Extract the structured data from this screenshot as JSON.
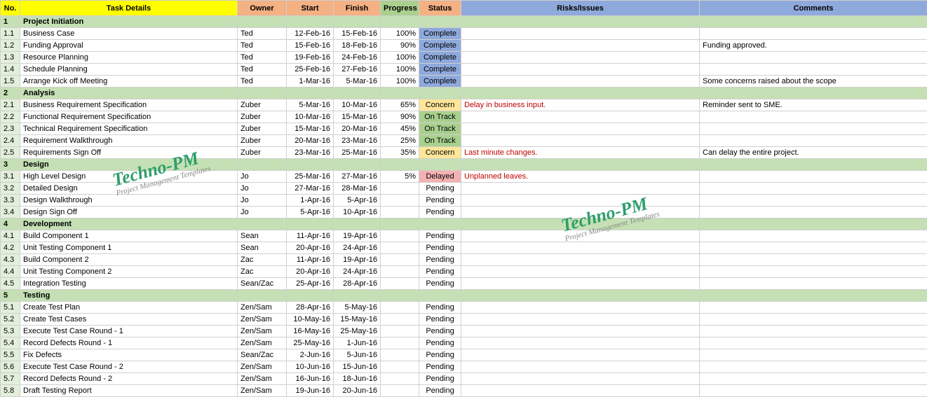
{
  "headers": {
    "no": "No.",
    "task": "Task Details",
    "owner": "Owner",
    "start": "Start",
    "finish": "Finish",
    "progress": "Progress",
    "status": "Status",
    "risks": "Risks/Issues",
    "comments": "Comments"
  },
  "watermark": {
    "main": "Techno-PM",
    "sub": "Project Management Templates"
  },
  "rows": [
    {
      "type": "section",
      "no": "1",
      "task": "Project Initiation"
    },
    {
      "type": "data",
      "no": "1.1",
      "task": "Business Case",
      "owner": "Ted",
      "start": "12-Feb-16",
      "finish": "15-Feb-16",
      "progress": "100%",
      "status": "Complete",
      "statusClass": "st-complete",
      "risk": "",
      "comment": ""
    },
    {
      "type": "data",
      "no": "1.2",
      "task": "Funding Approval",
      "owner": "Ted",
      "start": "15-Feb-16",
      "finish": "18-Feb-16",
      "progress": "90%",
      "status": "Complete",
      "statusClass": "st-complete",
      "risk": "",
      "comment": "Funding approved."
    },
    {
      "type": "data",
      "no": "1.3",
      "task": "Resource Planning",
      "owner": "Ted",
      "start": "19-Feb-16",
      "finish": "24-Feb-16",
      "progress": "100%",
      "status": "Complete",
      "statusClass": "st-complete",
      "risk": "",
      "comment": ""
    },
    {
      "type": "data",
      "no": "1.4",
      "task": "Schedule Planning",
      "owner": "Ted",
      "start": "25-Feb-16",
      "finish": "27-Feb-16",
      "progress": "100%",
      "status": "Complete",
      "statusClass": "st-complete",
      "risk": "",
      "comment": ""
    },
    {
      "type": "data",
      "no": "1.5",
      "task": "Arrange Kick off Meeting",
      "owner": "Ted",
      "start": "1-Mar-16",
      "finish": "5-Mar-16",
      "progress": "100%",
      "status": "Complete",
      "statusClass": "st-complete",
      "risk": "",
      "comment": "Some concerns raised about the scope"
    },
    {
      "type": "section",
      "no": "2",
      "task": "Analysis"
    },
    {
      "type": "data",
      "no": "2.1",
      "task": "Business Requirement Specification",
      "owner": "Zuber",
      "start": "5-Mar-16",
      "finish": "10-Mar-16",
      "progress": "65%",
      "status": "Concern",
      "statusClass": "st-concern",
      "risk": "Delay in business input.",
      "comment": "Reminder sent to SME."
    },
    {
      "type": "data",
      "no": "2.2",
      "task": "Functional Requirement Specification",
      "owner": "Zuber",
      "start": "10-Mar-16",
      "finish": "15-Mar-16",
      "progress": "90%",
      "status": "On Track",
      "statusClass": "st-ontrack",
      "risk": "",
      "comment": ""
    },
    {
      "type": "data",
      "no": "2.3",
      "task": "Technical Requirement Specification",
      "owner": "Zuber",
      "start": "15-Mar-16",
      "finish": "20-Mar-16",
      "progress": "45%",
      "status": "On Track",
      "statusClass": "st-ontrack",
      "risk": "",
      "comment": ""
    },
    {
      "type": "data",
      "no": "2.4",
      "task": "Requirement Walkthrough",
      "owner": "Zuber",
      "start": "20-Mar-16",
      "finish": "23-Mar-16",
      "progress": "25%",
      "status": "On Track",
      "statusClass": "st-ontrack",
      "risk": "",
      "comment": ""
    },
    {
      "type": "data",
      "no": "2.5",
      "task": "Requirements Sign Off",
      "owner": "Zuber",
      "start": "23-Mar-16",
      "finish": "25-Mar-16",
      "progress": "35%",
      "status": "Concern",
      "statusClass": "st-concern",
      "risk": "Last minute changes.",
      "comment": "Can delay the entire project."
    },
    {
      "type": "section",
      "no": "3",
      "task": "Design"
    },
    {
      "type": "data",
      "no": "3.1",
      "task": "High Level Design",
      "owner": "Jo",
      "start": "25-Mar-16",
      "finish": "27-Mar-16",
      "progress": "5%",
      "status": "Delayed",
      "statusClass": "st-delayed",
      "risk": "Unplanned leaves.",
      "comment": ""
    },
    {
      "type": "data",
      "no": "3.2",
      "task": "Detailed Design",
      "owner": "Jo",
      "start": "27-Mar-16",
      "finish": "28-Mar-16",
      "progress": "",
      "status": "Pending",
      "statusClass": "",
      "risk": "",
      "comment": ""
    },
    {
      "type": "data",
      "no": "3.3",
      "task": "Design Walkthrough",
      "owner": "Jo",
      "start": "1-Apr-16",
      "finish": "5-Apr-16",
      "progress": "",
      "status": "Pending",
      "statusClass": "",
      "risk": "",
      "comment": ""
    },
    {
      "type": "data",
      "no": "3.4",
      "task": "Design Sign Off",
      "owner": "Jo",
      "start": "5-Apr-16",
      "finish": "10-Apr-16",
      "progress": "",
      "status": "Pending",
      "statusClass": "",
      "risk": "",
      "comment": ""
    },
    {
      "type": "section",
      "no": "4",
      "task": "Development"
    },
    {
      "type": "data",
      "no": "4.1",
      "task": "Build Component 1",
      "owner": "Sean",
      "start": "11-Apr-16",
      "finish": "19-Apr-16",
      "progress": "",
      "status": "Pending",
      "statusClass": "",
      "risk": "",
      "comment": ""
    },
    {
      "type": "data",
      "no": "4.2",
      "task": "Unit Testing Component 1",
      "owner": "Sean",
      "start": "20-Apr-16",
      "finish": "24-Apr-16",
      "progress": "",
      "status": "Pending",
      "statusClass": "",
      "risk": "",
      "comment": ""
    },
    {
      "type": "data",
      "no": "4.3",
      "task": "Build Component 2",
      "owner": "Zac",
      "start": "11-Apr-16",
      "finish": "19-Apr-16",
      "progress": "",
      "status": "Pending",
      "statusClass": "",
      "risk": "",
      "comment": ""
    },
    {
      "type": "data",
      "no": "4.4",
      "task": "Unit Testing Component 2",
      "owner": "Zac",
      "start": "20-Apr-16",
      "finish": "24-Apr-16",
      "progress": "",
      "status": "Pending",
      "statusClass": "",
      "risk": "",
      "comment": ""
    },
    {
      "type": "data",
      "no": "4.5",
      "task": "Integration Testing",
      "owner": "Sean/Zac",
      "start": "25-Apr-16",
      "finish": "28-Apr-16",
      "progress": "",
      "status": "Pending",
      "statusClass": "",
      "risk": "",
      "comment": ""
    },
    {
      "type": "section",
      "no": "5",
      "task": "Testing"
    },
    {
      "type": "data",
      "no": "5.1",
      "task": "Create Test Plan",
      "owner": "Zen/Sam",
      "start": "28-Apr-16",
      "finish": "5-May-16",
      "progress": "",
      "status": "Pending",
      "statusClass": "",
      "risk": "",
      "comment": ""
    },
    {
      "type": "data",
      "no": "5.2",
      "task": "Create Test Cases",
      "owner": "Zen/Sam",
      "start": "10-May-16",
      "finish": "15-May-16",
      "progress": "",
      "status": "Pending",
      "statusClass": "",
      "risk": "",
      "comment": ""
    },
    {
      "type": "data",
      "no": "5.3",
      "task": "Execute Test Case Round - 1",
      "owner": "Zen/Sam",
      "start": "16-May-16",
      "finish": "25-May-16",
      "progress": "",
      "status": "Pending",
      "statusClass": "",
      "risk": "",
      "comment": ""
    },
    {
      "type": "data",
      "no": "5.4",
      "task": "Record Defects Round - 1",
      "owner": "Zen/Sam",
      "start": "25-May-16",
      "finish": "1-Jun-16",
      "progress": "",
      "status": "Pending",
      "statusClass": "",
      "risk": "",
      "comment": ""
    },
    {
      "type": "data",
      "no": "5.5",
      "task": "Fix Defects",
      "owner": "Sean/Zac",
      "start": "2-Jun-16",
      "finish": "5-Jun-16",
      "progress": "",
      "status": "Pending",
      "statusClass": "",
      "risk": "",
      "comment": ""
    },
    {
      "type": "data",
      "no": "5.6",
      "task": "Execute Test Case Round - 2",
      "owner": "Zen/Sam",
      "start": "10-Jun-16",
      "finish": "15-Jun-16",
      "progress": "",
      "status": "Pending",
      "statusClass": "",
      "risk": "",
      "comment": ""
    },
    {
      "type": "data",
      "no": "5.7",
      "task": "Record Defects Round - 2",
      "owner": "Zen/Sam",
      "start": "16-Jun-16",
      "finish": "18-Jun-16",
      "progress": "",
      "status": "Pending",
      "statusClass": "",
      "risk": "",
      "comment": ""
    },
    {
      "type": "data",
      "no": "5.8",
      "task": "Draft Testing Report",
      "owner": "Zen/Sam",
      "start": "19-Jun-16",
      "finish": "20-Jun-16",
      "progress": "",
      "status": "Pending",
      "statusClass": "",
      "risk": "",
      "comment": ""
    }
  ]
}
